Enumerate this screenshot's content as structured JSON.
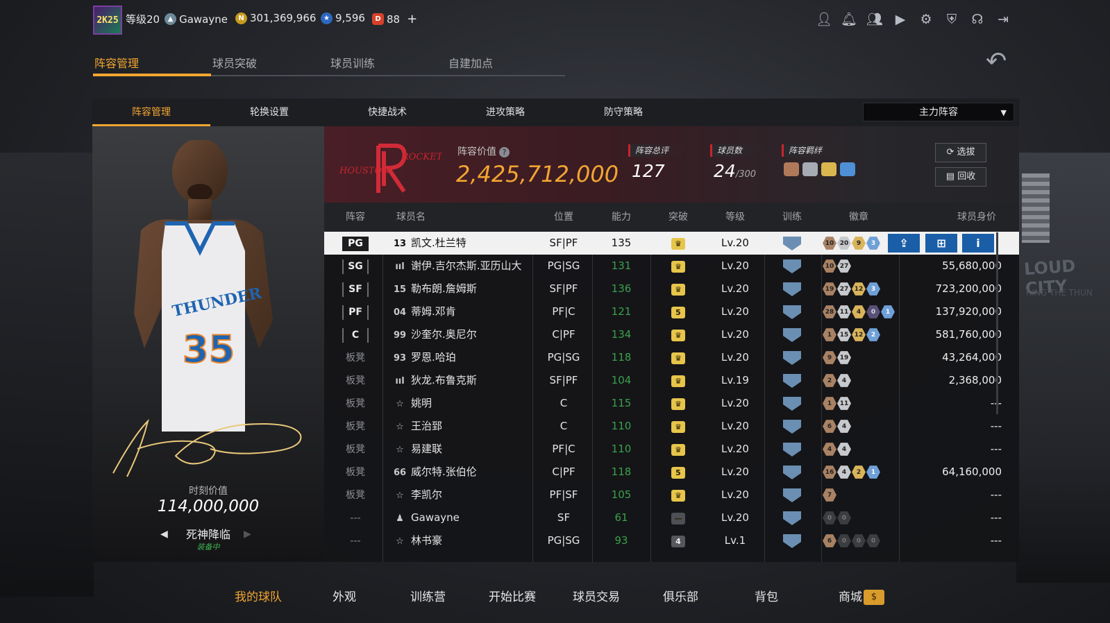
{
  "topbar": {
    "avatar_text": "2K25",
    "level": "等级20",
    "username": "Gawayne",
    "coins": "301,369,966",
    "stars": "9,596",
    "tickets": "88",
    "add": "+",
    "icons": [
      "user-icon",
      "bell-icon",
      "friends-icon",
      "video-icon",
      "gear-icon",
      "shield-icon",
      "headset-icon",
      "exit-icon"
    ]
  },
  "main_tabs": [
    "阵容管理",
    "球员突破",
    "球员训练",
    "自建加点"
  ],
  "sub_tabs": [
    "阵容管理",
    "轮换设置",
    "快捷战术",
    "进攻策略",
    "防守策略"
  ],
  "lineup_select": "主力阵容",
  "card": {
    "jersey_number": "35",
    "jersey_team": "THUNDER",
    "moment_value_label": "时刻价值",
    "moment_value": "114,000,000",
    "skin_name": "死神降临",
    "skin_status": "装备中"
  },
  "team_header": {
    "team_logo_text": "HOUSTON ROCKETS",
    "team_value_label": "阵容价值",
    "team_value": "2,425,712,000",
    "rating_label": "阵容总评",
    "rating": "127",
    "players_label": "球员数",
    "players_count": "24",
    "players_max": "/300",
    "bonds_label": "阵容羁绊",
    "select_btn": "选拔",
    "recycle_btn": "回收"
  },
  "columns": [
    "阵容",
    "球员名",
    "位置",
    "能力",
    "突破",
    "等级",
    "训练",
    "徽章",
    "球员身价"
  ],
  "rows": [
    {
      "slot": "PG",
      "jersey": "13",
      "name": "凯文.杜兰特",
      "pos": "SF|PF",
      "power": "135",
      "brk": "crown",
      "level": "Lv.20",
      "badges": [
        [
          "10",
          "b"
        ],
        [
          "20",
          "s"
        ],
        [
          "9",
          "g"
        ],
        [
          "3",
          "p"
        ]
      ],
      "price": "",
      "selected": true
    },
    {
      "slot": "SG",
      "jersey": "ııl",
      "name": "谢伊.吉尔杰斯.亚历山大",
      "pos": "PG|SG",
      "power": "131",
      "brk": "crown",
      "level": "Lv.20",
      "badges": [
        [
          "10",
          "b"
        ],
        [
          "27",
          "s"
        ]
      ],
      "price": "55,680,000"
    },
    {
      "slot": "SF",
      "jersey": "15",
      "name": "勒布朗.詹姆斯",
      "pos": "SF|PF",
      "power": "136",
      "brk": "crown",
      "level": "Lv.20",
      "badges": [
        [
          "19",
          "b"
        ],
        [
          "27",
          "s"
        ],
        [
          "12",
          "g"
        ],
        [
          "3",
          "p"
        ]
      ],
      "price": "723,200,000"
    },
    {
      "slot": "PF",
      "jersey": "04",
      "name": "蒂姆.邓肯",
      "pos": "PF|C",
      "power": "121",
      "brk": "5",
      "level": "Lv.20",
      "badges": [
        [
          "28",
          "b"
        ],
        [
          "11",
          "s"
        ],
        [
          "4",
          "g"
        ],
        [
          "0",
          "v"
        ],
        [
          "1",
          "p"
        ]
      ],
      "price": "137,920,000"
    },
    {
      "slot": "C",
      "jersey": "99",
      "name": "沙奎尔.奥尼尔",
      "pos": "C|PF",
      "power": "134",
      "brk": "crown",
      "level": "Lv.20",
      "badges": [
        [
          "1",
          "b"
        ],
        [
          "15",
          "s"
        ],
        [
          "12",
          "g"
        ],
        [
          "2",
          "p"
        ]
      ],
      "price": "581,760,000"
    },
    {
      "slot": "板凳",
      "jersey": "93",
      "name": "罗恩.哈珀",
      "pos": "PG|SG",
      "power": "118",
      "brk": "crown",
      "level": "Lv.20",
      "badges": [
        [
          "9",
          "b"
        ],
        [
          "19",
          "s"
        ]
      ],
      "price": "43,264,000"
    },
    {
      "slot": "板凳",
      "jersey": "ııl",
      "name": "狄龙.布鲁克斯",
      "pos": "SF|PF",
      "power": "104",
      "brk": "crown",
      "level": "Lv.19",
      "badges": [
        [
          "2",
          "b"
        ],
        [
          "4",
          "s"
        ]
      ],
      "price": "2,368,000"
    },
    {
      "slot": "板凳",
      "jersey": "☆",
      "name": "姚明",
      "pos": "C",
      "power": "115",
      "brk": "crown",
      "level": "Lv.20",
      "badges": [
        [
          "1",
          "b"
        ],
        [
          "11",
          "s"
        ]
      ],
      "price": "---"
    },
    {
      "slot": "板凳",
      "jersey": "☆",
      "name": "王治郅",
      "pos": "C",
      "power": "110",
      "brk": "crown",
      "level": "Lv.20",
      "badges": [
        [
          "6",
          "b"
        ],
        [
          "4",
          "s"
        ]
      ],
      "price": "---"
    },
    {
      "slot": "板凳",
      "jersey": "☆",
      "name": "易建联",
      "pos": "PF|C",
      "power": "110",
      "brk": "crown",
      "level": "Lv.20",
      "badges": [
        [
          "4",
          "b"
        ],
        [
          "4",
          "s"
        ]
      ],
      "price": "---"
    },
    {
      "slot": "板凳",
      "jersey": "66",
      "name": "威尔特.张伯伦",
      "pos": "C|PF",
      "power": "118",
      "brk": "5",
      "level": "Lv.20",
      "badges": [
        [
          "16",
          "b"
        ],
        [
          "4",
          "s"
        ],
        [
          "2",
          "g"
        ],
        [
          "1",
          "p"
        ]
      ],
      "price": "64,160,000"
    },
    {
      "slot": "板凳",
      "jersey": "☆",
      "name": "李凯尔",
      "pos": "PF|SF",
      "power": "105",
      "brk": "crown",
      "level": "Lv.20",
      "badges": [
        [
          "7",
          "b"
        ]
      ],
      "price": "---"
    },
    {
      "slot": "---",
      "jersey": "♟",
      "name": "Gawayne",
      "pos": "SF",
      "power": "61",
      "brk": "none",
      "level": "Lv.20",
      "badges": [
        [
          "0",
          "e"
        ],
        [
          "0",
          "e"
        ]
      ],
      "price": "---"
    },
    {
      "slot": "---",
      "jersey": "☆",
      "name": "林书豪",
      "pos": "PG|SG",
      "power": "93",
      "brk": "4",
      "level": "Lv.1",
      "badges": [
        [
          "6",
          "b"
        ],
        [
          "0",
          "e"
        ],
        [
          "0",
          "e"
        ],
        [
          "0",
          "e"
        ]
      ],
      "price": "---"
    }
  ],
  "bottom_nav": [
    "我的球队",
    "外观",
    "训练营",
    "开始比赛",
    "球员交易",
    "俱乐部",
    "背包",
    "商城"
  ],
  "shop_badge": "$",
  "colors": {
    "accent": "#f2a531",
    "team_red": "#c9242f",
    "power_green": "#3aa14c",
    "action_blue": "#1b5ea8"
  }
}
